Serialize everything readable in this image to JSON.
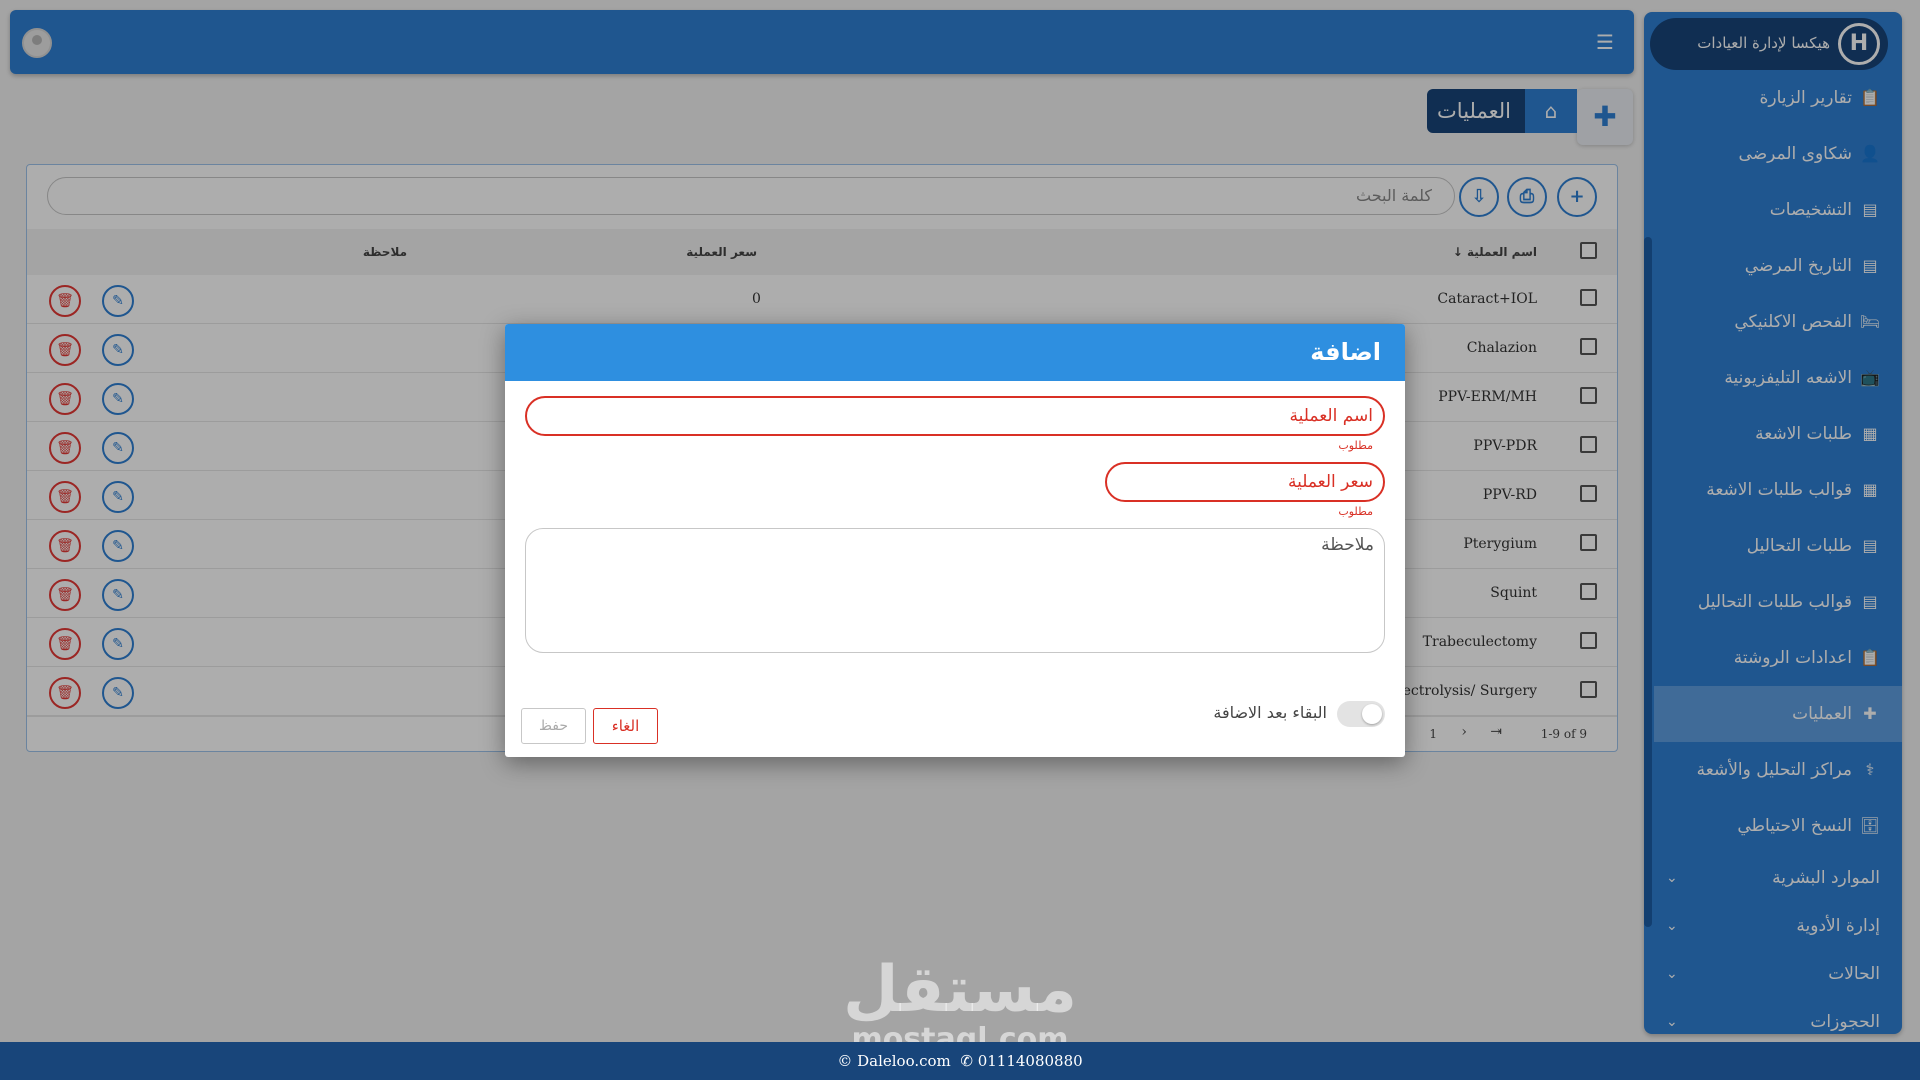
{
  "brand": {
    "name": "هيكسا لإدارة العيادات",
    "logo_letter": "H"
  },
  "sidebar": {
    "items": [
      {
        "label": "تقارير الزيارة",
        "icon": "clipboard-icon"
      },
      {
        "label": "شكاوى المرضى",
        "icon": "user-complaint-icon"
      },
      {
        "label": "التشخيصات",
        "icon": "document-icon"
      },
      {
        "label": "التاريخ المرضي",
        "icon": "history-document-icon"
      },
      {
        "label": "الفحص الاكلنيكي",
        "icon": "bed-icon"
      },
      {
        "label": "الاشعه التليفزيونية",
        "icon": "tv-icon"
      },
      {
        "label": "طلبات الاشعة",
        "icon": "radiology-icon"
      },
      {
        "label": "قوالب طلبات الاشعة",
        "icon": "radiology-template-icon"
      },
      {
        "label": "طلبات التحاليل",
        "icon": "lab-document-icon"
      },
      {
        "label": "قوالب طلبات التحاليل",
        "icon": "lab-template-icon"
      },
      {
        "label": "اعدادات الروشتة",
        "icon": "prescription-icon"
      },
      {
        "label": "العمليات",
        "icon": "bandage-icon"
      },
      {
        "label": "مراكز التحليل والأشعة",
        "icon": "centers-icon"
      },
      {
        "label": "النسخ الاحتياطي",
        "icon": "database-icon"
      }
    ],
    "groups": [
      {
        "label": "الموارد البشرية"
      },
      {
        "label": "إدارة الأدوية"
      },
      {
        "label": "الحالات"
      },
      {
        "label": "الحجوزات"
      }
    ]
  },
  "breadcrumb": {
    "title": "العمليات"
  },
  "toolbar": {
    "search_placeholder": "كلمة البحث"
  },
  "table": {
    "headers": {
      "name": "اسم العملية",
      "price": "سعر العملية",
      "note": "ملاحظة"
    },
    "rows": [
      {
        "name": "Cataract+IOL",
        "price": "0"
      },
      {
        "name": "Chalazion",
        "price": ""
      },
      {
        "name": "PPV-ERM/MH",
        "price": ""
      },
      {
        "name": "PPV-PDR",
        "price": ""
      },
      {
        "name": "PPV-RD",
        "price": ""
      },
      {
        "name": "Pterygium",
        "price": ""
      },
      {
        "name": "Squint",
        "price": ""
      },
      {
        "name": "Trabeculectomy",
        "price": ""
      },
      {
        "name": "s/ Electrolysis/ Surgery",
        "price": ""
      }
    ],
    "pager": {
      "range": "1-9 of 9",
      "page": "1"
    }
  },
  "dialog": {
    "title": "اضافة",
    "name_label": "اسم العملية",
    "price_label": "سعر العملية",
    "required": "مطلوب",
    "note_label": "ملاحظة",
    "stay_label": "البقاء بعد الاضافة",
    "cancel_label": "الغاء",
    "save_label": "حفظ"
  },
  "footer": {
    "site": "Daleloo.com",
    "phone": "01114080880"
  },
  "watermark": {
    "arabic": "مستقل",
    "latin": "mostaql.com"
  },
  "colors": {
    "primary": "#2e7fd3",
    "dark": "#18457a",
    "danger": "#d93025"
  }
}
